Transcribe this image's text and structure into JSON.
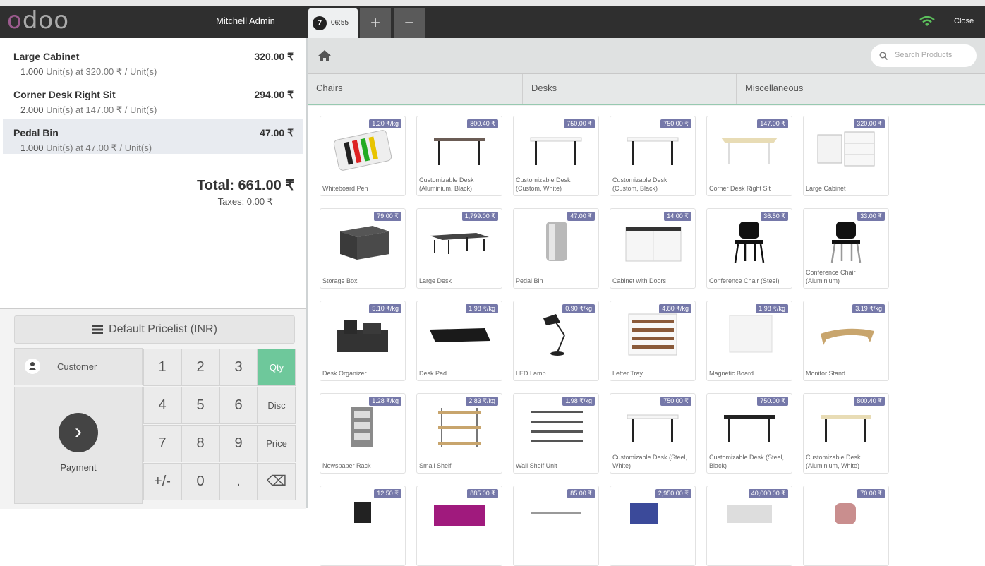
{
  "header": {
    "logo": "odoo",
    "cashier": "Mitchell Admin",
    "order_tab": {
      "number": "7",
      "time": "06:55"
    },
    "add_order": "+",
    "remove_order": "−",
    "close": "Close"
  },
  "order": {
    "lines": [
      {
        "name": "Large Cabinet",
        "price": "320.00 ₹",
        "qty": "1.000",
        "info": "Unit(s) at 320.00 ₹ / Unit(s)",
        "selected": false
      },
      {
        "name": "Corner Desk Right Sit",
        "price": "294.00 ₹",
        "qty": "2.000",
        "info": "Unit(s) at 147.00 ₹ / Unit(s)",
        "selected": false
      },
      {
        "name": "Pedal Bin",
        "price": "47.00 ₹",
        "qty": "1.000",
        "info": "Unit(s) at 47.00 ₹ / Unit(s)",
        "selected": true
      }
    ],
    "total": "Total: 661.00 ₹",
    "taxes": "Taxes: 0.00 ₹"
  },
  "controls": {
    "pricelist": "Default Pricelist (INR)",
    "customer": "Customer",
    "payment": "Payment",
    "numpad": [
      "1",
      "2",
      "3",
      "Qty",
      "4",
      "5",
      "6",
      "Disc",
      "7",
      "8",
      "9",
      "Price",
      "+/-",
      "0",
      ".",
      "⌫"
    ],
    "active_mode": "Qty"
  },
  "products_screen": {
    "search_placeholder": "Search Products",
    "categories": [
      "Chairs",
      "Desks",
      "Miscellaneous"
    ],
    "products": [
      {
        "name": "Whiteboard Pen",
        "price": "1.20 ₹/kg"
      },
      {
        "name": "Customizable Desk (Aluminium, Black)",
        "price": "800.40 ₹"
      },
      {
        "name": "Customizable Desk (Custom, White)",
        "price": "750.00 ₹"
      },
      {
        "name": "Customizable Desk (Custom, Black)",
        "price": "750.00 ₹"
      },
      {
        "name": "Corner Desk Right Sit",
        "price": "147.00 ₹"
      },
      {
        "name": "Large Cabinet",
        "price": "320.00 ₹"
      },
      {
        "name": "Storage Box",
        "price": "79.00 ₹"
      },
      {
        "name": "Large Desk",
        "price": "1,799.00 ₹"
      },
      {
        "name": "Pedal Bin",
        "price": "47.00 ₹"
      },
      {
        "name": "Cabinet with Doors",
        "price": "14.00 ₹"
      },
      {
        "name": "Conference Chair (Steel)",
        "price": "36.50 ₹"
      },
      {
        "name": "Conference Chair (Aluminium)",
        "price": "33.00 ₹"
      },
      {
        "name": "Desk Organizer",
        "price": "5.10 ₹/kg"
      },
      {
        "name": "Desk Pad",
        "price": "1.98 ₹/kg"
      },
      {
        "name": "LED Lamp",
        "price": "0.90 ₹/kg"
      },
      {
        "name": "Letter Tray",
        "price": "4.80 ₹/kg"
      },
      {
        "name": "Magnetic Board",
        "price": "1.98 ₹/kg"
      },
      {
        "name": "Monitor Stand",
        "price": "3.19 ₹/kg"
      },
      {
        "name": "Newspaper Rack",
        "price": "1.28 ₹/kg"
      },
      {
        "name": "Small Shelf",
        "price": "2.83 ₹/kg"
      },
      {
        "name": "Wall Shelf Unit",
        "price": "1.98 ₹/kg"
      },
      {
        "name": "Customizable Desk (Steel, White)",
        "price": "750.00 ₹"
      },
      {
        "name": "Customizable Desk (Steel, Black)",
        "price": "750.00 ₹"
      },
      {
        "name": "Customizable Desk (Aluminium, White)",
        "price": "800.40 ₹"
      },
      {
        "name": "",
        "price": "12.50 ₹"
      },
      {
        "name": "",
        "price": "885.00 ₹"
      },
      {
        "name": "",
        "price": "85.00 ₹"
      },
      {
        "name": "",
        "price": "2,950.00 ₹"
      },
      {
        "name": "",
        "price": "40,000.00 ₹"
      },
      {
        "name": "",
        "price": "70.00 ₹"
      }
    ]
  }
}
